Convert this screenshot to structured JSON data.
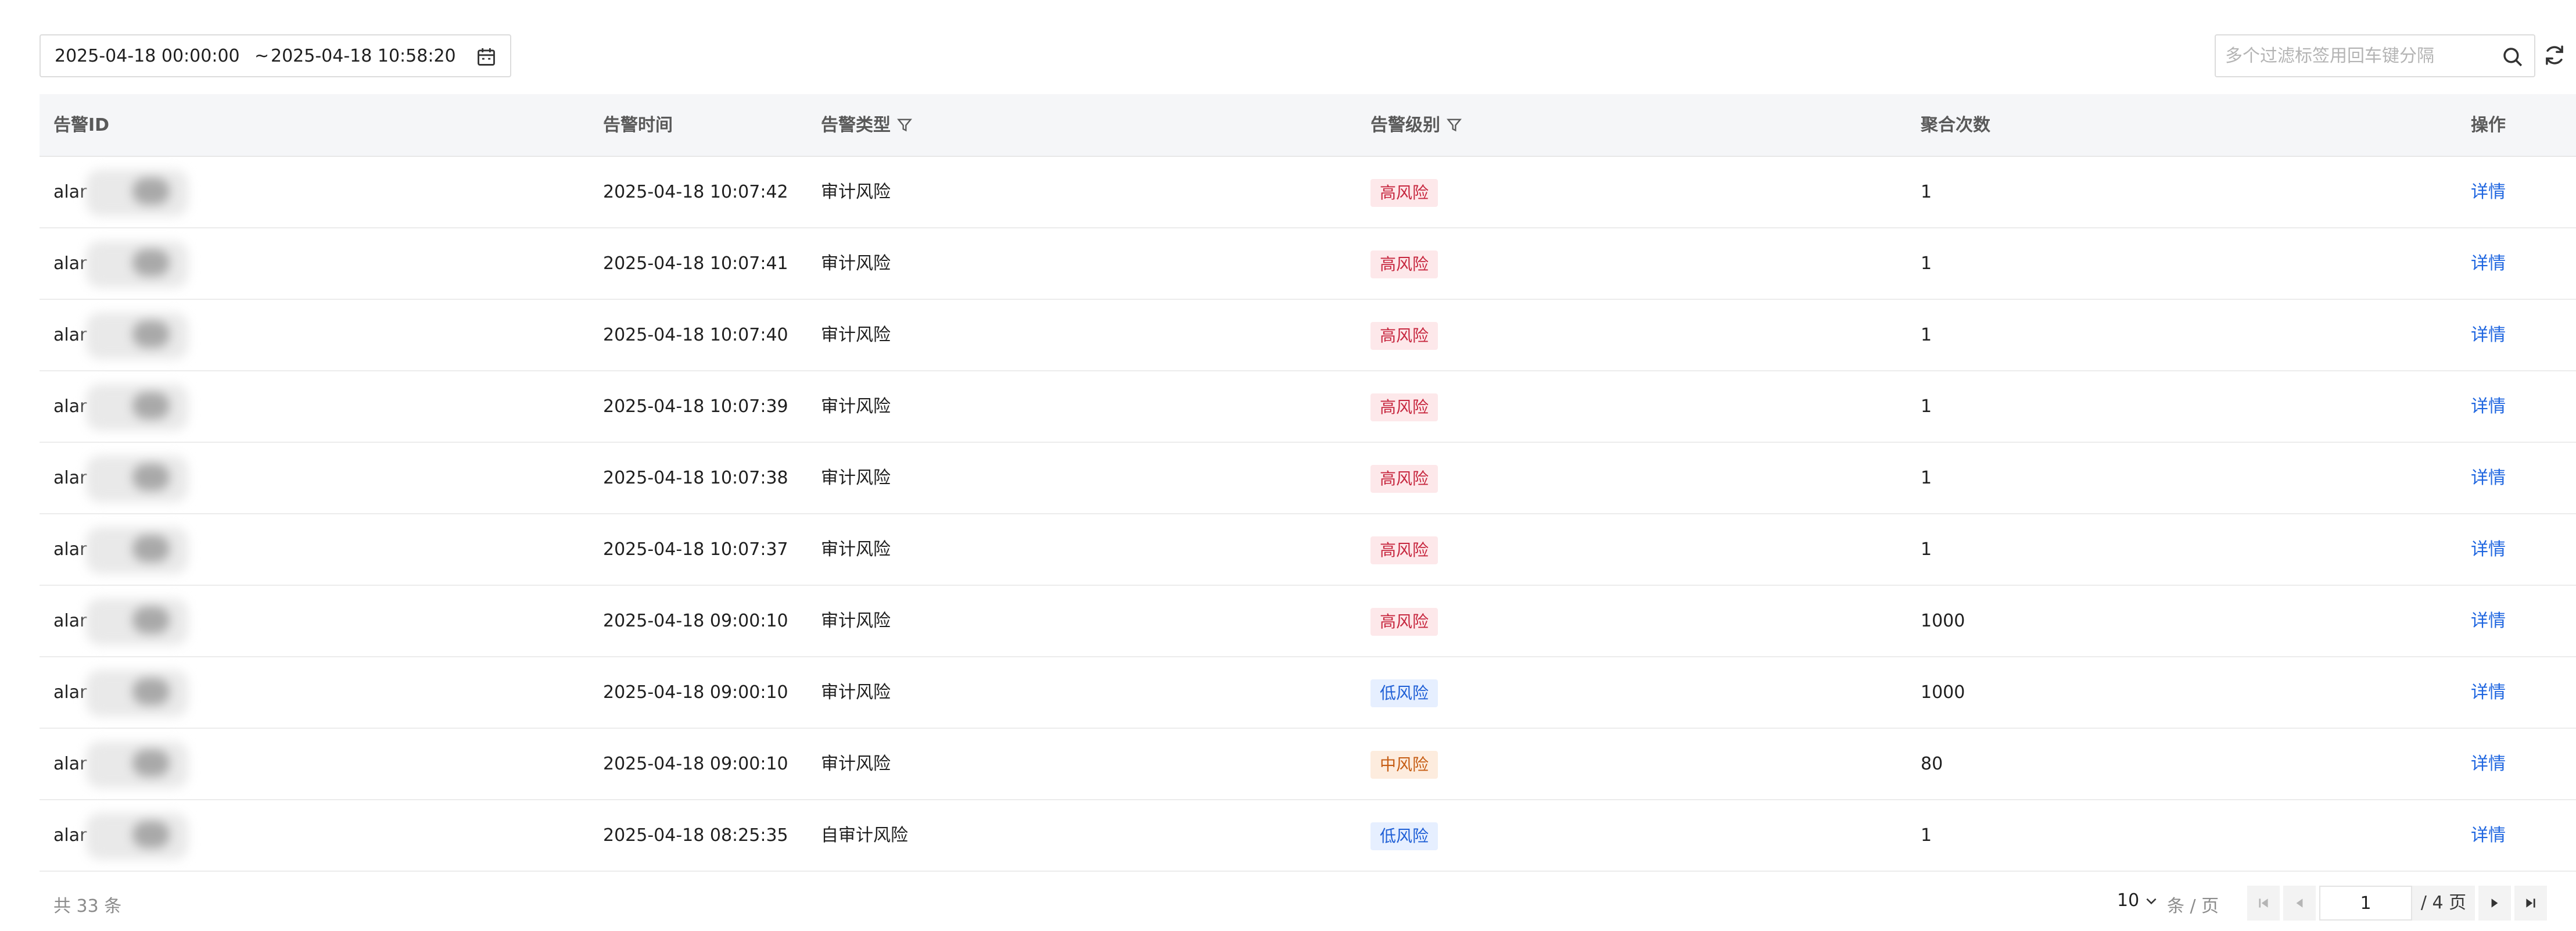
{
  "toolbar": {
    "date_start": "2025-04-18 00:00:00",
    "date_separator": "~",
    "date_end": "2025-04-18 10:58:20",
    "search_placeholder": "多个过滤标签用回车键分隔"
  },
  "table": {
    "columns": [
      "告警ID",
      "告警时间",
      "告警类型",
      "告警级别",
      "聚合次数",
      "操作"
    ],
    "rows": [
      {
        "id": "alar",
        "time": "2025-04-18 10:07:42",
        "type": "审计风险",
        "level": "高风险",
        "count": "1",
        "action": "详情"
      },
      {
        "id": "alar",
        "time": "2025-04-18 10:07:41",
        "type": "审计风险",
        "level": "高风险",
        "count": "1",
        "action": "详情"
      },
      {
        "id": "alar",
        "time": "2025-04-18 10:07:40",
        "type": "审计风险",
        "level": "高风险",
        "count": "1",
        "action": "详情"
      },
      {
        "id": "alar",
        "time": "2025-04-18 10:07:39",
        "type": "审计风险",
        "level": "高风险",
        "count": "1",
        "action": "详情"
      },
      {
        "id": "alar",
        "time": "2025-04-18 10:07:38",
        "type": "审计风险",
        "level": "高风险",
        "count": "1",
        "action": "详情"
      },
      {
        "id": "alar",
        "time": "2025-04-18 10:07:37",
        "type": "审计风险",
        "level": "高风险",
        "count": "1",
        "action": "详情"
      },
      {
        "id": "alar",
        "time": "2025-04-18 09:00:10",
        "type": "审计风险",
        "level": "高风险",
        "count": "1000",
        "action": "详情"
      },
      {
        "id": "alar",
        "time": "2025-04-18 09:00:10",
        "type": "审计风险",
        "level": "低风险",
        "count": "1000",
        "action": "详情"
      },
      {
        "id": "alar",
        "time": "2025-04-18 09:00:10",
        "type": "审计风险",
        "level": "中风险",
        "count": "80",
        "action": "详情"
      },
      {
        "id": "alar",
        "time": "2025-04-18 08:25:35",
        "type": "自审计风险",
        "level": "低风险",
        "count": "1",
        "action": "详情"
      }
    ]
  },
  "level_colors": {
    "高风险": "#c7273f",
    "中风险": "#c65d14",
    "低风险": "#1f5fd6"
  },
  "footer": {
    "total_label": "共 33 条",
    "page_size": "10",
    "page_size_unit": "条 / 页",
    "current_page": "1",
    "total_pages_label": "/ 4 页"
  }
}
